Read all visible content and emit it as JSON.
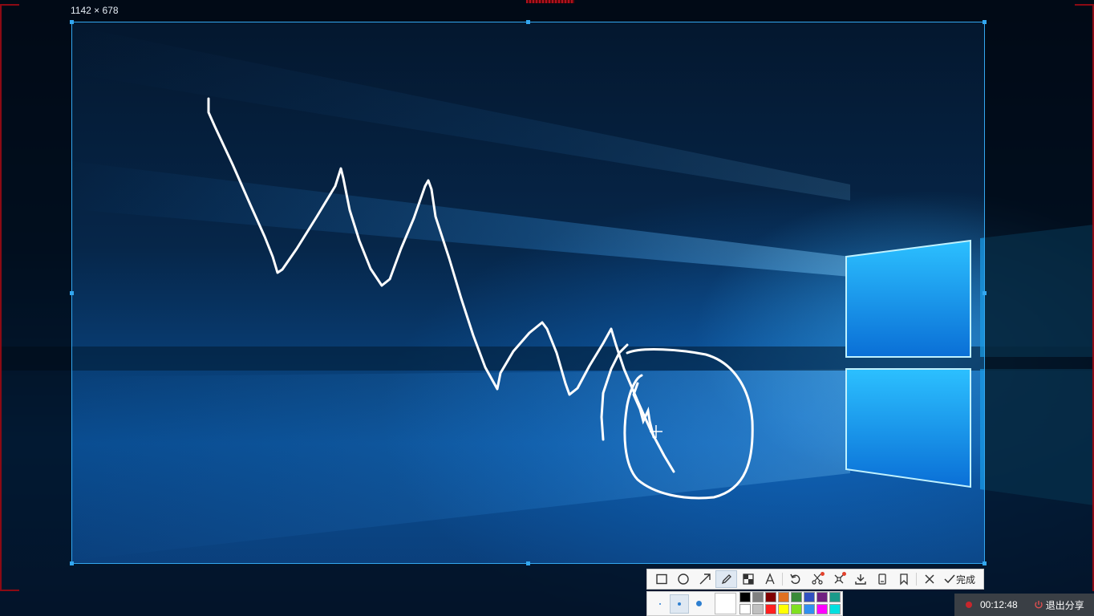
{
  "capture": {
    "size_label": "1142 × 678"
  },
  "toolbar": {
    "tools": [
      {
        "icon": "rectangle-icon"
      },
      {
        "icon": "ellipse-icon"
      },
      {
        "icon": "arrow-icon"
      },
      {
        "icon": "pencil-icon",
        "active": true
      },
      {
        "icon": "mosaic-icon"
      },
      {
        "icon": "text-icon"
      },
      {
        "icon": "undo-icon"
      },
      {
        "icon": "scissors-icon"
      },
      {
        "icon": "crop-icon"
      },
      {
        "icon": "download-icon"
      },
      {
        "icon": "save-icon"
      },
      {
        "icon": "pin-icon"
      },
      {
        "icon": "close-icon"
      }
    ],
    "done_label": "完成"
  },
  "properties": {
    "pen_sizes": [
      "small",
      "medium",
      "large"
    ],
    "selected_size": "medium",
    "current_color": "#ffffff",
    "palette": [
      "#000000",
      "#808080",
      "#800000",
      "#e07020",
      "#3a8a3a",
      "#3050c0",
      "#702080",
      "#1a9a8a",
      "#ffffff",
      "#c0c0c0",
      "#ff2020",
      "#ffff00",
      "#80e020",
      "#3090f0",
      "#ff00ff",
      "#00e0e0"
    ]
  },
  "share_bar": {
    "timer": "00:12:48",
    "exit_label": "退出分享"
  },
  "colors": {
    "selection_border": "#33a7f0",
    "share_frame": "#8c0a14",
    "pen_stroke": "#ffffff"
  }
}
